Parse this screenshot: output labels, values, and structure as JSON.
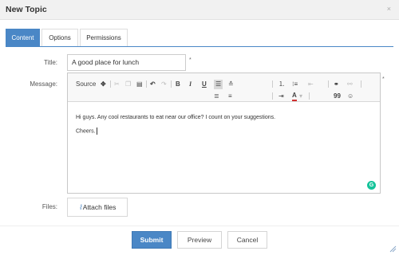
{
  "dialog": {
    "title": "New Topic",
    "close_glyph": "×"
  },
  "tabs": [
    "Content",
    "Options",
    "Permissions"
  ],
  "form": {
    "title_label": "Title:",
    "title_value": "A good place for lunch",
    "required_mark": "*",
    "message_label": "Message:",
    "files_label": "Files:"
  },
  "editor": {
    "toolbar": {
      "source_label": "Source",
      "bold": "B",
      "italic": "I",
      "underline": "U",
      "font_color": "A",
      "quote": "99"
    },
    "body_lines": [
      "Hi guys. Any cool restaurants to eat near our office? I count on your suggestions.",
      "Cheers."
    ],
    "grammarly_badge": "G",
    "badge_color": "#15c39a"
  },
  "attach": {
    "label": "Attach files",
    "icon": "paperclip-icon"
  },
  "buttons": {
    "submit": "Submit",
    "preview": "Preview",
    "cancel": "Cancel"
  },
  "colors": {
    "accent": "#4a87c6"
  }
}
